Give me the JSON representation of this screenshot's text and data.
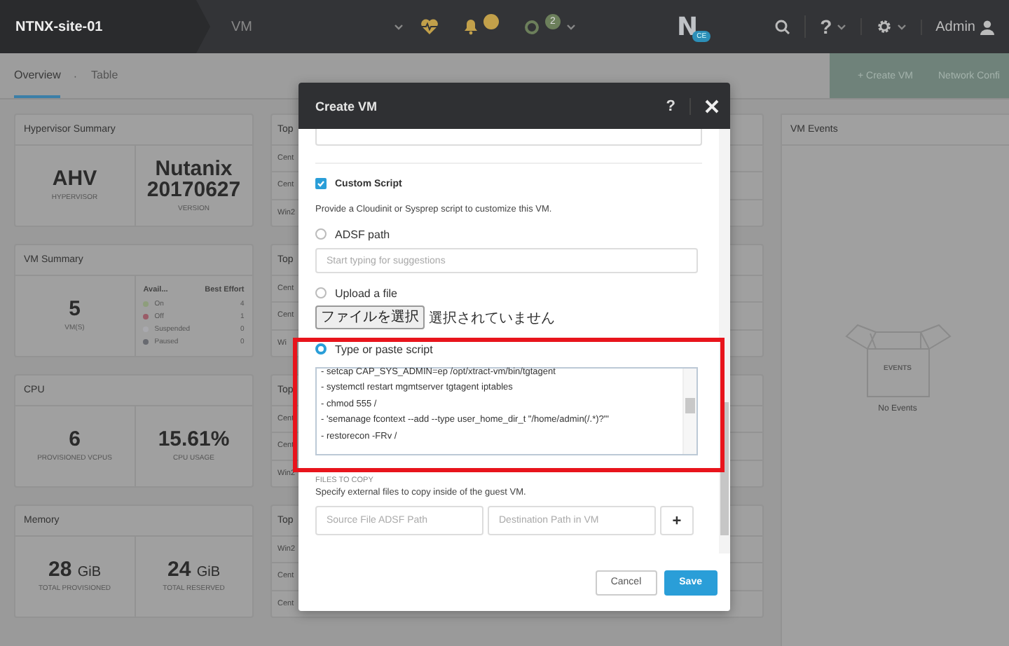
{
  "top_bar": {
    "cluster": "NTNX-site-01",
    "section": "VM",
    "tasks_badge": "2",
    "logo_letter": "N",
    "logo_badge": "CE",
    "help": "?",
    "user": "Admin"
  },
  "sub_nav": {
    "tabs": [
      {
        "label": "Overview",
        "selected": true
      },
      {
        "label": "Table",
        "selected": false
      }
    ],
    "separator": "·",
    "actions": [
      "+ Create VM",
      "Network Confi"
    ]
  },
  "summary_cards": [
    {
      "kind": "stats",
      "title": "Hypervisor Summary",
      "items": [
        {
          "value": "AHV",
          "label": "HYPERVISOR"
        },
        {
          "value": "Nutanix 20170627",
          "label": "VERSION"
        }
      ]
    },
    {
      "kind": "vm",
      "title": "VM Summary",
      "count": "5",
      "count_label": "VM(S)",
      "columns": [
        "Avail...",
        "Best Effort"
      ],
      "states": [
        {
          "name": "On",
          "count": "4",
          "color": "#8e9e7c"
        },
        {
          "name": "Off",
          "count": "1",
          "color": "#9a5c68"
        },
        {
          "name": "Suspended",
          "count": "0",
          "color": "#a9a9ae"
        },
        {
          "name": "Paused",
          "count": "0",
          "color": "#686a70"
        }
      ]
    },
    {
      "kind": "stats",
      "title": "CPU",
      "items": [
        {
          "value": "6",
          "label": "PROVISIONED VCPUS"
        },
        {
          "value": "15.61%",
          "label": "CPU USAGE"
        }
      ]
    },
    {
      "kind": "stats",
      "title": "Memory",
      "items": [
        {
          "value": "28",
          "unit": "GiB",
          "label": "TOTAL PROVISIONED"
        },
        {
          "value": "24",
          "unit": "GiB",
          "label": "TOTAL RESERVED"
        }
      ]
    }
  ],
  "top_lists": [
    {
      "title": "Top",
      "rows": [
        "Cent",
        "Cent",
        "Win2"
      ]
    },
    {
      "title": "Top",
      "rows": [
        "Cent",
        "Cent",
        "Wi"
      ]
    },
    {
      "title": "Top",
      "rows": [
        "Cent",
        "Cent",
        "Win2"
      ]
    },
    {
      "title": "Top",
      "rows": [
        "Win2",
        "Cent",
        "Cent"
      ]
    }
  ],
  "vm_events": {
    "title": "VM Events",
    "box_label": "EVENTS",
    "empty_text": "No Events"
  },
  "modal": {
    "title": "Create VM",
    "help": "?",
    "custom_script": {
      "label": "Custom Script",
      "checked": true
    },
    "description": "Provide a Cloudinit or Sysprep script to customize this VM.",
    "sources": [
      {
        "kind": "path",
        "label": "ADSF path",
        "selected": false,
        "placeholder": "Start typing for suggestions"
      },
      {
        "kind": "file",
        "label": "Upload a file",
        "selected": false,
        "button": "ファイルを選択",
        "status": "選択されていません"
      },
      {
        "kind": "script",
        "label": "Type or paste script",
        "selected": true,
        "lines": [
          "- setcap CAP_SYS_ADMIN=ep /opt/xtract-vm/bin/tgtagent",
          "- systemctl restart mgmtserver tgtagent iptables",
          "- chmod 555 /",
          "- 'semanage fcontext --add --type user_home_dir_t \"/home/admin(/.*)?\"'",
          "- restorecon -FRv /"
        ]
      }
    ],
    "files_heading": "FILES TO COPY",
    "files_description": "Specify external files to copy inside of the guest VM.",
    "source_placeholder": "Source File ADSF Path",
    "destination_placeholder": "Destination Path in VM",
    "add_button": "+",
    "buttons": [
      "Cancel",
      "Save"
    ]
  }
}
